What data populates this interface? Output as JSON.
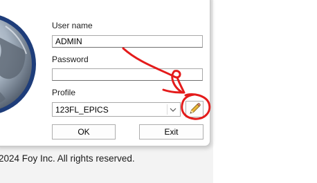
{
  "login": {
    "username_label": "User name",
    "username_value": "ADMIN",
    "password_label": "Password",
    "password_value": "",
    "profile_label": "Profile",
    "profile_value": "123FL_EPICS"
  },
  "buttons": {
    "ok_label": "OK",
    "exit_label": "Exit",
    "edit_profile_icon": "pencil-icon"
  },
  "footer": {
    "copyright": "2024 Foy Inc. All rights reserved."
  },
  "colors": {
    "annotation_red": "#e41b1b",
    "globe_blue": "#1e3d7a"
  }
}
